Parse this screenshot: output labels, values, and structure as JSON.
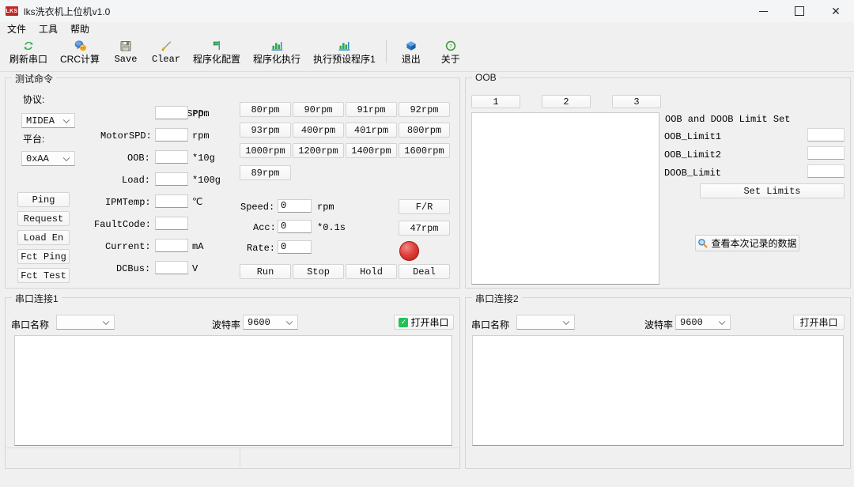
{
  "window": {
    "app_badge": "LKS",
    "title": "lks洗衣机上位机v1.0",
    "minimize": "–",
    "maximize": "□",
    "close": "✕"
  },
  "menubar": {
    "items": [
      {
        "label": "文件",
        "name": "menu-file"
      },
      {
        "label": "工具",
        "name": "menu-tools"
      },
      {
        "label": "帮助",
        "name": "menu-help"
      }
    ]
  },
  "toolbar": {
    "buttons": [
      {
        "label": "刷新串口",
        "icon": "refresh-icon",
        "name": "toolbar-refresh-serial"
      },
      {
        "label": "CRC计算",
        "icon": "crc-chat-icon",
        "name": "toolbar-crc-calc"
      },
      {
        "label": "Save",
        "icon": "save-floppy-icon",
        "name": "toolbar-save"
      },
      {
        "label": "Clear",
        "icon": "broom-icon",
        "name": "toolbar-clear"
      },
      {
        "label": "程序化配置",
        "icon": "flag-chart-icon",
        "name": "toolbar-program-config"
      },
      {
        "label": "程序化执行",
        "icon": "bar-chart-icon",
        "name": "toolbar-program-run"
      },
      {
        "label": "执行预设程序1",
        "icon": "bar-chart-icon",
        "name": "toolbar-run-preset-1"
      },
      {
        "label": "退出",
        "icon": "exit-cube-icon",
        "name": "toolbar-exit"
      },
      {
        "label": "关于",
        "icon": "about-question-icon",
        "name": "toolbar-about"
      }
    ]
  },
  "test_commands": {
    "title": "测试命令",
    "protocol_label": "协议:",
    "protocol_value": "MIDEA",
    "platform_label": "平台:",
    "platform_value": "0xAA",
    "side_buttons": [
      {
        "label": "Ping",
        "name": "ping-button"
      },
      {
        "label": "Request",
        "name": "request-button"
      },
      {
        "label": "Load En",
        "name": "load-en-button"
      },
      {
        "label": "Fct Ping",
        "name": "fct-ping-button"
      },
      {
        "label": "Fct Test",
        "name": "fct-test-button"
      }
    ],
    "readouts": [
      {
        "label": "DrumSPD:",
        "value": "",
        "unit": "rpm",
        "name": "drum-spd"
      },
      {
        "label": "MotorSPD:",
        "value": "",
        "unit": "rpm",
        "name": "motor-spd"
      },
      {
        "label": "OOB:",
        "value": "",
        "unit": "*10g",
        "name": "oob-value"
      },
      {
        "label": "Load:",
        "value": "",
        "unit": "*100g",
        "name": "load-value"
      },
      {
        "label": "IPMTemp:",
        "value": "",
        "unit": "℃",
        "name": "ipm-temp"
      },
      {
        "label": "FaultCode:",
        "value": "",
        "unit": "",
        "name": "fault-code"
      },
      {
        "label": "Current:",
        "value": "",
        "unit": "mA",
        "name": "current-value"
      },
      {
        "label": "DCBus:",
        "value": "",
        "unit": "V",
        "name": "dcbus-value"
      }
    ],
    "rpm_buttons": [
      "80rpm",
      "90rpm",
      "91rpm",
      "92rpm",
      "93rpm",
      "400rpm",
      "401rpm",
      "800rpm",
      "1000rpm",
      "1200rpm",
      "1400rpm",
      "1600rpm",
      "89rpm"
    ],
    "speed_label": "Speed:",
    "speed_value": "0",
    "speed_unit": "rpm",
    "acc_label": "Acc:",
    "acc_value": "0",
    "acc_unit": "*0.1s",
    "rate_label": "Rate:",
    "rate_value": "0",
    "fr_button": "F/R",
    "rpm47_button": "47rpm",
    "led_color": "#e0413c",
    "action_buttons": [
      "Run",
      "Stop",
      "Hold",
      "Deal"
    ]
  },
  "oob": {
    "title": "OOB",
    "tab_buttons": [
      "1",
      "2",
      "3"
    ],
    "limit_header": "OOB and DOOB Limit Set",
    "limits": [
      {
        "label": "OOB_Limit1",
        "value": "",
        "name": "oob-limit1-input"
      },
      {
        "label": "OOB_Limit2",
        "value": "",
        "name": "oob-limit2-input"
      },
      {
        "label": "DOOB_Limit",
        "value": "",
        "name": "doob-limit-input"
      }
    ],
    "set_limits_button": "Set Limits",
    "view_records_button": "查看本次记录的数据",
    "view_records_icon": "magnifier-icon"
  },
  "serial1": {
    "title": "串口连接1",
    "port_label": "串口名称",
    "port_value": "",
    "baud_label": "波特率",
    "baud_value": "9600",
    "open_label": "打开串口",
    "open_checked": true,
    "log_value": ""
  },
  "serial2": {
    "title": "串口连接2",
    "port_label": "串口名称",
    "port_value": "",
    "baud_label": "波特率",
    "baud_value": "9600",
    "open_label": "打开串口",
    "open_checked": false,
    "log_value": ""
  }
}
